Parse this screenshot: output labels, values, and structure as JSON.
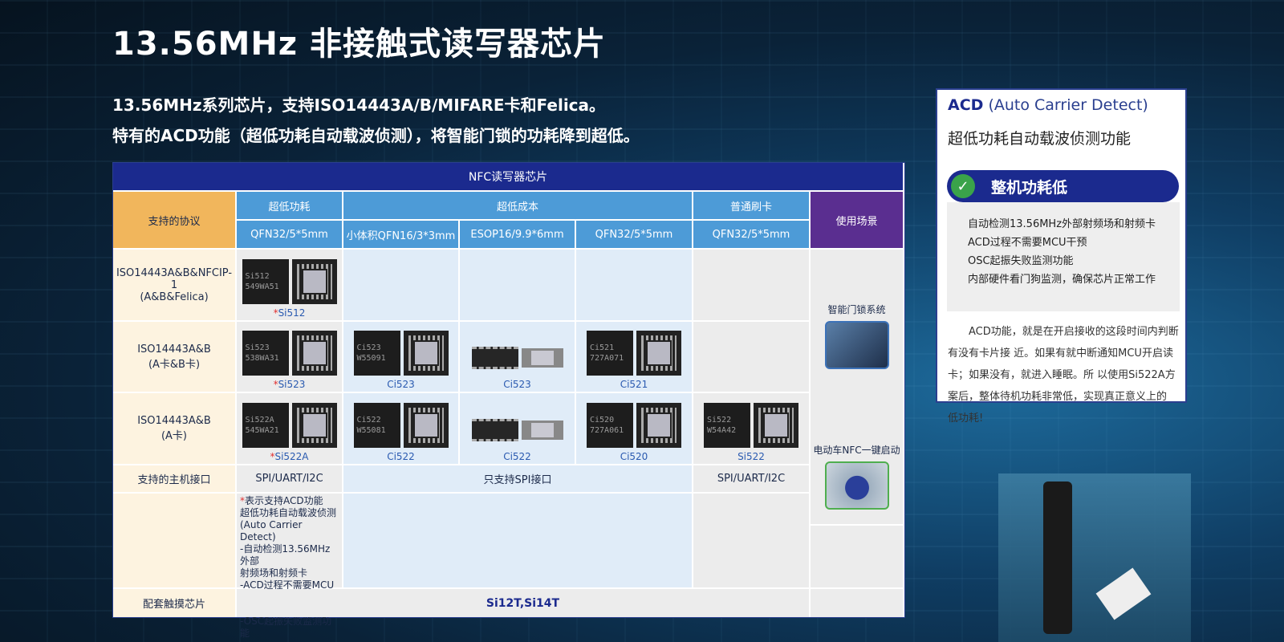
{
  "headline": "13.56MHz 非接触式读写器芯片",
  "subtitle1": "13.56MHz系列芯片，支持ISO14443A/B/MIFARE卡和Felica。",
  "subtitle2": "特有的ACD功能（超低功耗自动载波侦测），将智能门锁的功耗降到超低。",
  "table": {
    "title": "NFC读写器芯片",
    "protocol_header": "支持的协议",
    "group_low_power": "超低功耗",
    "group_low_cost": "超低成本",
    "group_standard": "普通刷卡",
    "scene_header": "使用场景",
    "pkg_1": "QFN32/5*5mm",
    "pkg_2": "小体积QFN16/3*3mm",
    "pkg_3": "ESOP16/9.9*6mm",
    "pkg_4": "QFN32/5*5mm",
    "pkg_5": "QFN32/5*5mm",
    "row1_protocol_a": "ISO14443A&B&NFCIP-1",
    "row1_protocol_b": "(A&B&Felica)",
    "row2_protocol_a": "ISO14443A&B",
    "row2_protocol_b": "(A卡&B卡)",
    "row3_protocol_a": "ISO14443A&B",
    "row3_protocol_b": "(A卡)",
    "chip_si512_mark1": "Si512",
    "chip_si512_mark2": "549WA51",
    "chip_si523_mark1": "Si523",
    "chip_si523_mark2": "538WA31",
    "chip_ci523_mark1": "Ci523",
    "chip_ci523_mark2": "W55091",
    "chip_ci521_mark1": "Ci521",
    "chip_ci521_mark2": "727A071",
    "chip_si522a_mark1": "Si522A",
    "chip_si522a_mark2": "545WA21",
    "chip_ci522_mark1": "Ci522",
    "chip_ci522_mark2": "W55081",
    "chip_ci520_mark1": "Ci520",
    "chip_ci520_mark2": "727A061",
    "chip_si522_mark1": "Si522",
    "chip_si522_mark2": "W54A42",
    "label_star": "*",
    "label_si512": "Si512",
    "label_si523": "Si523",
    "label_ci523_qfn": "Ci523",
    "label_ci523_esop": "Ci523",
    "label_ci521": "Ci521",
    "label_si522a": "Si522A",
    "label_ci522_qfn": "Ci522",
    "label_ci522_esop": "Ci522",
    "label_ci520": "Ci520",
    "label_si522": "Si522",
    "scene_smart_lock": "智能门锁系统",
    "scene_ebike": "电动车NFC一键启动",
    "host_interface": "支持的主机接口",
    "host_low_power": "SPI/UART/I2C",
    "host_low_cost": "只支持SPI接口",
    "host_standard": "SPI/UART/I2C",
    "note_star_line": "表示支持ACD功能",
    "note_lines": [
      "超低功耗自动载波侦测",
      "(Auto Carrier Detect)",
      "-自动检测13.56MHz外部",
      "射频场和射频卡",
      "-ACD过程不需要MCU干",
      "预",
      "-OSC起振失败监测功能"
    ],
    "touch_chip_label": "配套触摸芯片",
    "touch_chip_value": "Si12T,Si14T"
  },
  "acd_panel": {
    "title_abbr": "ACD",
    "title_full": " (Auto Carrier Detect)",
    "subtitle": "超低功耗自动载波侦测功能",
    "pill_label": "整机功耗低",
    "features": [
      "自动检测13.56MHz外部射频场和射频卡",
      "ACD过程不需要MCU干预",
      "OSC起振失败监测功能",
      "内部硬件看门狗监测，确保芯片正常工作"
    ],
    "paragraph": "ACD功能，就是在开启接收的这段时间内判断有没有卡片接 近。如果有就中断通知MCU开启读卡；如果没有，就进入睡眠。所 以使用Si522A方案后，整体待机功耗非常低，实现真正意义上的 低功耗!"
  },
  "colors": {
    "header_navy": "#1b2a8e",
    "header_blue": "#4d9bd7",
    "protocol_orange": "#f1b65c",
    "scene_purple": "#5a2e90",
    "acd_red_star": "#e03030"
  },
  "icons": {
    "check": "check-circle-icon"
  }
}
